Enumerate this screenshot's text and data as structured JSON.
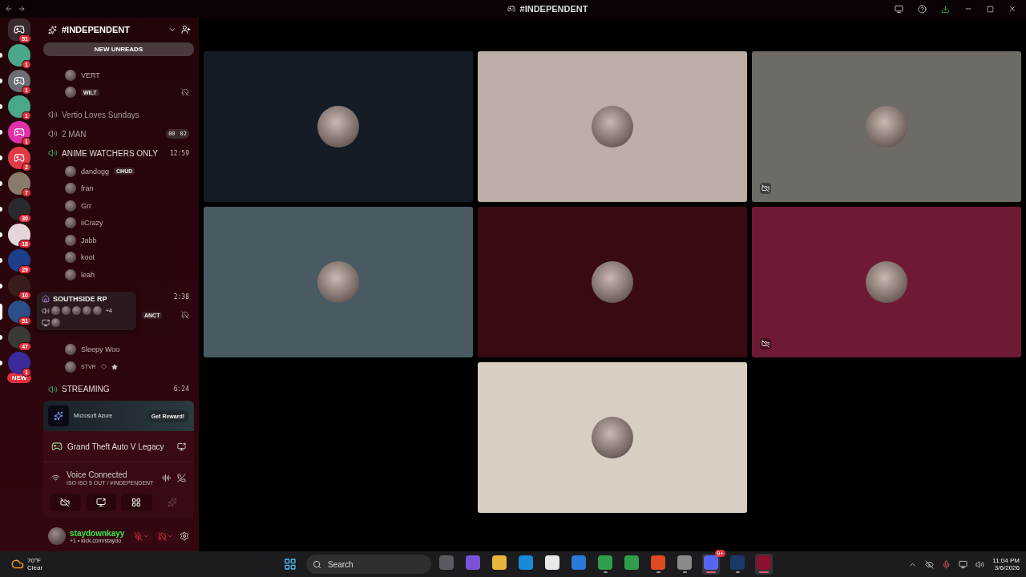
{
  "window": {
    "title": "#INDEPENDENT"
  },
  "servers": [
    {
      "kind": "logo",
      "color": "#3b2a30",
      "badge": "51",
      "unread": false,
      "hovered": false
    },
    {
      "kind": "art",
      "color": "#4aa88a",
      "badge": "1",
      "unread": true,
      "hovered": false
    },
    {
      "kind": "logo",
      "color": "#6b6d73",
      "badge": "1",
      "unread": true,
      "hovered": false
    },
    {
      "kind": "art",
      "color": "#4aa88a",
      "badge": "1",
      "unread": true,
      "hovered": false
    },
    {
      "kind": "logo",
      "color": "#e02fa8",
      "badge": "1",
      "unread": true,
      "hovered": false
    },
    {
      "kind": "logo",
      "color": "#e03a45",
      "badge": "2",
      "unread": true,
      "hovered": false
    },
    {
      "kind": "art",
      "color": "#8a7a6a",
      "badge": "7",
      "unread": true,
      "hovered": false
    },
    {
      "kind": "art",
      "color": "#2a2a2e",
      "badge": "30",
      "unread": true,
      "hovered": false
    },
    {
      "kind": "art",
      "color": "#e6d6dc",
      "badge": "18",
      "unread": true,
      "hovered": false
    },
    {
      "kind": "art",
      "color": "#1d3f8a",
      "badge": "29",
      "unread": true,
      "hovered": false
    },
    {
      "kind": "art",
      "color": "#3a1c1c",
      "badge": "10",
      "unread": true,
      "hovered": false
    },
    {
      "kind": "art",
      "color": "#2a4f8a",
      "badge": "51",
      "unread": false,
      "hovered": true
    },
    {
      "kind": "art",
      "color": "#3a3a34",
      "badge": "47",
      "unread": true,
      "hovered": false
    },
    {
      "kind": "art",
      "color": "#3a2a9a",
      "badge": "1",
      "unread": true,
      "hovered": false
    }
  ],
  "new_pill": "NEW",
  "channel_header": {
    "title": "#INDEPENDENT"
  },
  "unread_banner": "NEW UNREADS",
  "channel_items": [
    {
      "kind": "member",
      "name": "VERT"
    },
    {
      "kind": "member",
      "name": "WILT",
      "nameplate": true,
      "deafened": true
    },
    {
      "kind": "channel",
      "name": "Vertio Loves Sundays",
      "active": false
    },
    {
      "kind": "channel",
      "name": "2 MAN",
      "active": false,
      "counter": [
        "00",
        "02"
      ]
    },
    {
      "kind": "channel",
      "name": "ANIME WATCHERS ONLY",
      "active": true,
      "timer": "12:59"
    },
    {
      "kind": "member",
      "name": "dandogg",
      "tag": "CHUD"
    },
    {
      "kind": "member",
      "name": "fran"
    },
    {
      "kind": "member",
      "name": "Grr"
    },
    {
      "kind": "member",
      "name": "iiCrazy"
    },
    {
      "kind": "member",
      "name": "Jabb"
    },
    {
      "kind": "member",
      "name": "koot"
    },
    {
      "kind": "member",
      "name": "leah"
    },
    {
      "kind": "channel",
      "timer": "2:38"
    },
    {
      "kind": "member",
      "tag": "ANCT",
      "deafened": true
    },
    {
      "kind": "blank"
    },
    {
      "kind": "member",
      "name": "Sleepy Woo"
    },
    {
      "kind": "member",
      "name": "STVR",
      "small": true,
      "star": true
    },
    {
      "kind": "channel",
      "name": "STREAMING",
      "active": true,
      "timer": "6:24"
    }
  ],
  "server_tooltip": {
    "title": "SOUTHSIDE RP",
    "extra": "+4"
  },
  "promo": {
    "sponsor": "Microsoft Azure",
    "button": "Get Reward!"
  },
  "activity": {
    "game": "Grand Theft Auto V Legacy"
  },
  "voice": {
    "status": "Voice Connected",
    "channel": "ISO ISO 5 OUT / #INDEPENDENT"
  },
  "user": {
    "name": "staydownkayy",
    "status": "+1 • kick.com/staydo",
    "mic_muted": true,
    "deafened": true
  },
  "tiles": [
    {
      "color": "#151c26",
      "video_off": false
    },
    {
      "color": "#bcaea6",
      "video_off": false
    },
    {
      "color": "#6e6a65",
      "video_off": true
    },
    {
      "color": "#4a5a63",
      "video_off": false
    },
    {
      "color": "#3a0a12",
      "video_off": false
    },
    {
      "color": "#6e1a35",
      "video_off": true
    },
    {
      "color": "#d8cfc2",
      "video_off": false
    }
  ],
  "taskbar": {
    "temperature": "70°F",
    "condition": "Clear",
    "search": "Search",
    "time": "11:04 PM",
    "date": "3/6/2026",
    "apps": [
      {
        "color": "#5a5a60",
        "running": false,
        "active": false
      },
      {
        "color": "#7a52d8",
        "running": false,
        "active": false
      },
      {
        "color": "#e8b53a",
        "running": false,
        "active": false
      },
      {
        "color": "#1a8ad8",
        "running": false,
        "active": false
      },
      {
        "color": "#e8e8e8",
        "running": false,
        "active": false
      },
      {
        "color": "#2a7ad8",
        "running": false,
        "active": false
      },
      {
        "color": "#2f9e4a",
        "running": true,
        "active": false
      },
      {
        "color": "#2f9e4a",
        "running": false,
        "active": false
      },
      {
        "color": "#e04a20",
        "running": true,
        "active": false
      },
      {
        "color": "#8a8a8a",
        "running": true,
        "active": false
      },
      {
        "color": "#5865f2",
        "running": true,
        "active": true,
        "badge": "9+"
      },
      {
        "color": "#1a3a6a",
        "running": true,
        "active": false
      },
      {
        "color": "#8a1030",
        "running": true,
        "active": true
      }
    ]
  }
}
